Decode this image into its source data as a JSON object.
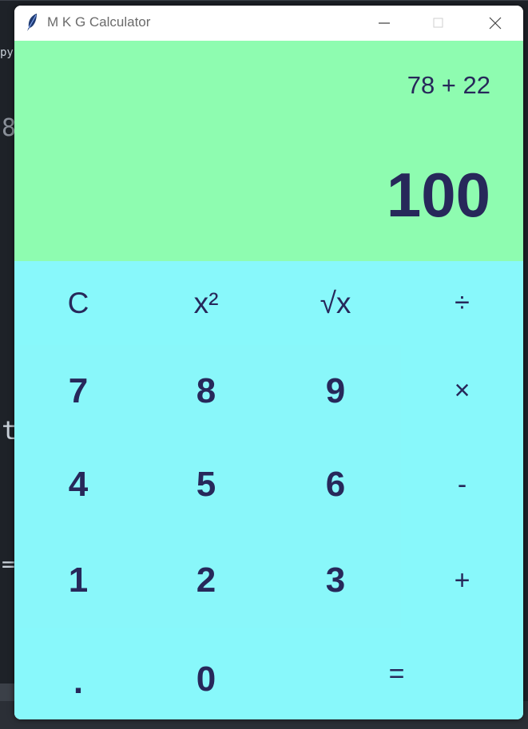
{
  "window": {
    "title": "M K G Calculator",
    "icon": "feather-icon",
    "controls": [
      "minimize-icon",
      "maximize-icon",
      "close-icon"
    ]
  },
  "display": {
    "expression": "78 + 22",
    "result": "100"
  },
  "keys": {
    "clear": "C",
    "square": "x²",
    "sqrt": "√x",
    "divide": "÷",
    "multiply": "×",
    "subtract": "-",
    "add": "+",
    "equals": "=",
    "decimal": ".",
    "d0": "0",
    "d1": "1",
    "d2": "2",
    "d3": "3",
    "d4": "4",
    "d5": "5",
    "d6": "6",
    "d7": "7",
    "d8": "8",
    "d9": "9"
  },
  "background_editor": {
    "fragments": [
      "py",
      "8",
      "t",
      "="
    ]
  },
  "colors": {
    "display_bg": "#8efcb0",
    "keypad_bg": "#88f8fb",
    "text": "#27285a"
  }
}
